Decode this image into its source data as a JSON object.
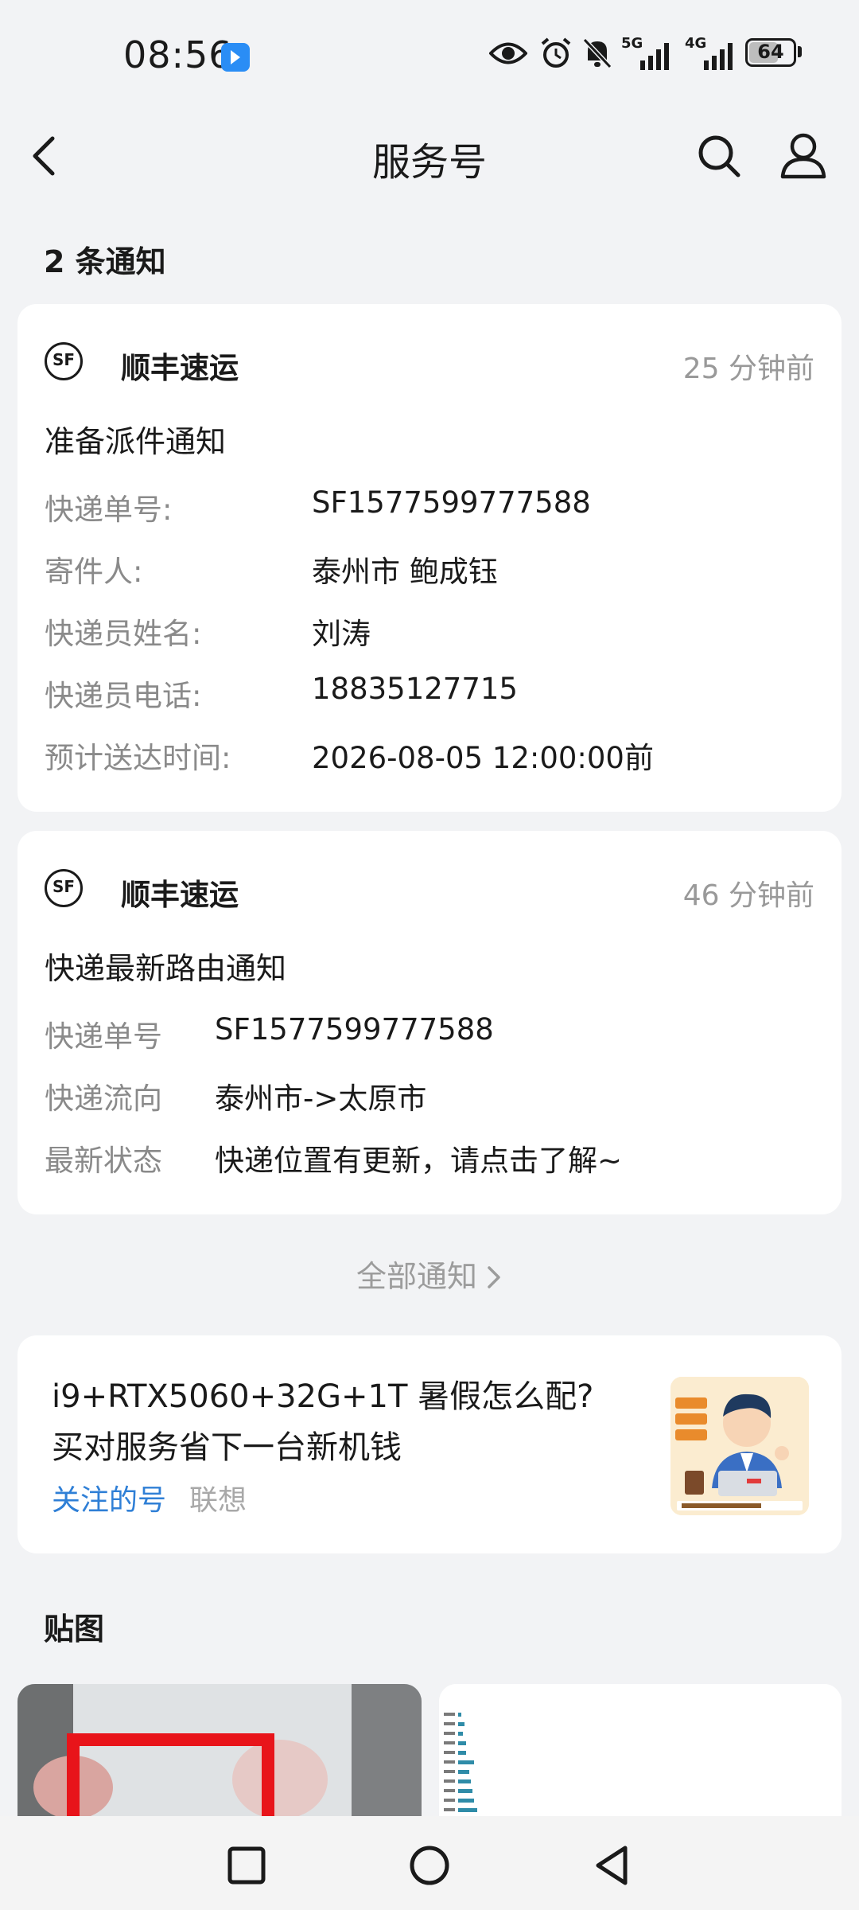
{
  "status_bar": {
    "time": "08:56",
    "network_1": "5G",
    "network_2": "4G",
    "battery": "64"
  },
  "nav": {
    "title": "服务号"
  },
  "notifications": {
    "count_label": "2 条通知",
    "cards": [
      {
        "sender": "顺丰速运",
        "time": "25 分钟前",
        "title": "准备派件通知",
        "fields": [
          {
            "label": "快递单号:",
            "value": "SF1577599777588"
          },
          {
            "label": "寄件人:",
            "value": "泰州市 鲍成钰"
          },
          {
            "label": "快递员姓名:",
            "value": "刘涛"
          },
          {
            "label": "快递员电话:",
            "value": "18835127715"
          },
          {
            "label": "预计送达时间:",
            "value": "2026-08-05 12:00:00前"
          }
        ]
      },
      {
        "sender": "顺丰速运",
        "time": "46 分钟前",
        "title": "快递最新路由通知",
        "fields": [
          {
            "label": "快递单号",
            "value": "SF1577599777588"
          },
          {
            "label": "快递流向",
            "value": "泰州市->太原市"
          },
          {
            "label": "最新状态",
            "value": "快递位置有更新，请点击了解~"
          }
        ]
      }
    ],
    "all_label": "全部通知"
  },
  "promo": {
    "line1": "i9+RTX5060+32G+1T 暑假怎么配?",
    "line2": "买对服务省下一台新机钱",
    "tag_followed": "关注的号",
    "tag_brand": "联想",
    "tag_color": "#2f7fd6"
  },
  "stickers": {
    "heading": "贴图"
  },
  "icons": {
    "logo": "SF"
  }
}
